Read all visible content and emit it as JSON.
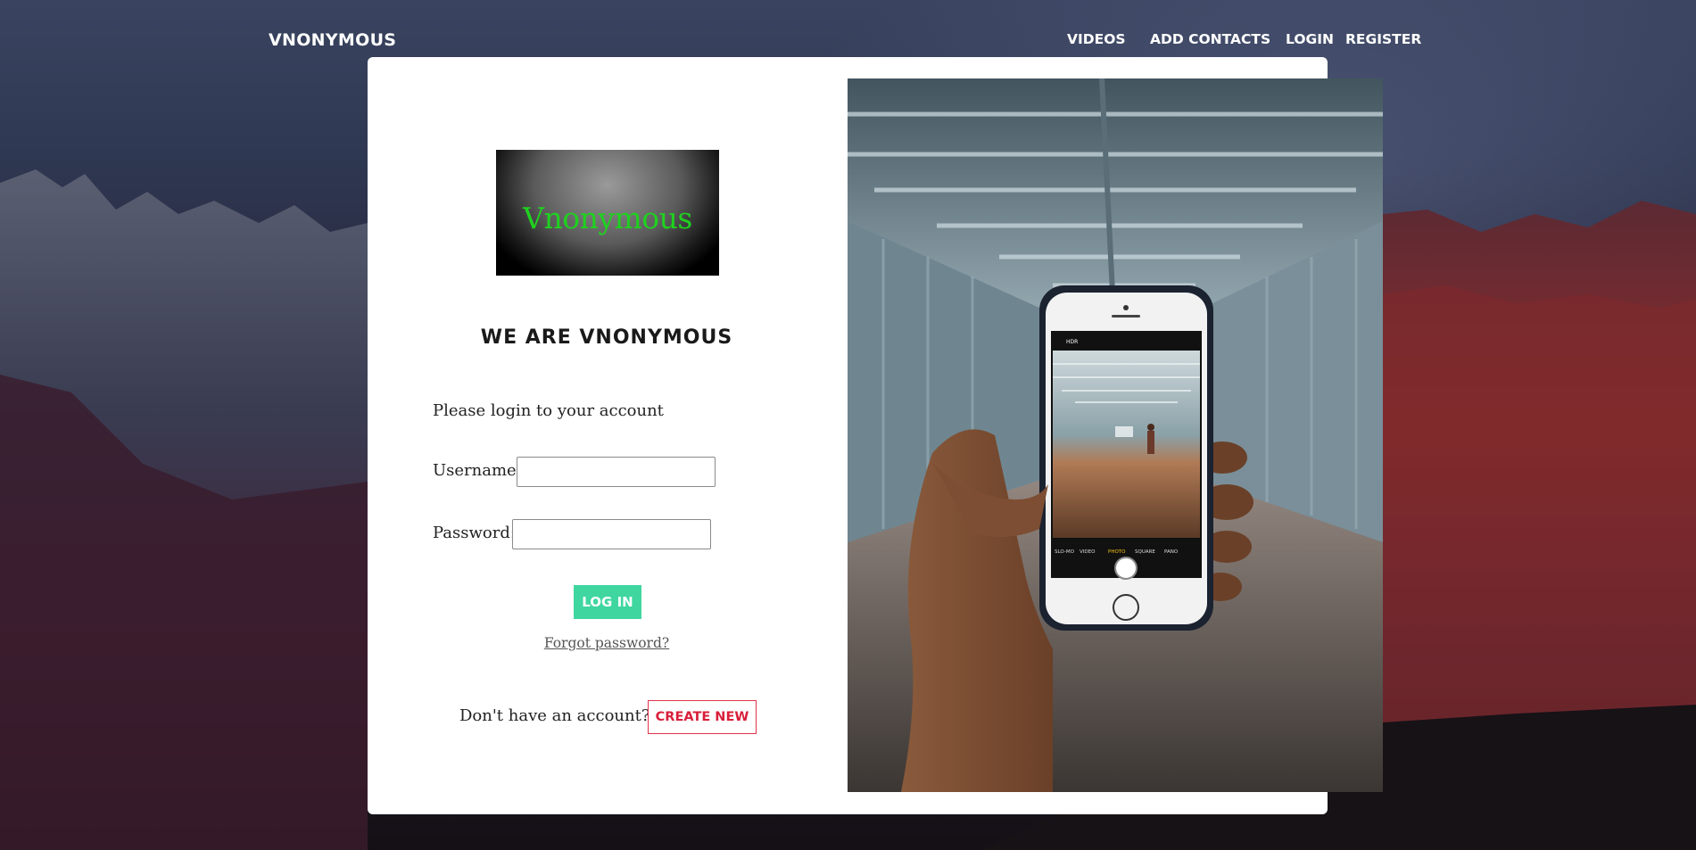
{
  "nav": {
    "brand": "VNONYMOUS",
    "links": [
      "VIDEOS",
      "ADD CONTACTS",
      "LOGIN",
      "REGISTER"
    ]
  },
  "login": {
    "logo_text": "Vnonymous",
    "tagline": "WE ARE VNONYMOUS",
    "prompt": "Please login to your account",
    "username_label": "Username:",
    "username_value": "",
    "password_label": "Password:",
    "password_value": "",
    "login_button": "LOG IN",
    "forgot_link": "Forgot password?",
    "no_account_text": "Don't have an account?",
    "create_button": "CREATE NEW"
  },
  "phone_screen": {
    "top_label": "HDR",
    "modes": [
      "SLO-MO",
      "VIDEO",
      "PHOTO",
      "SQUARE",
      "PANO"
    ],
    "active_mode": "PHOTO"
  },
  "colors": {
    "accent_green": "#3fd6a0",
    "create_red": "#d81f3a",
    "logo_text_green": "#1fd11f"
  }
}
